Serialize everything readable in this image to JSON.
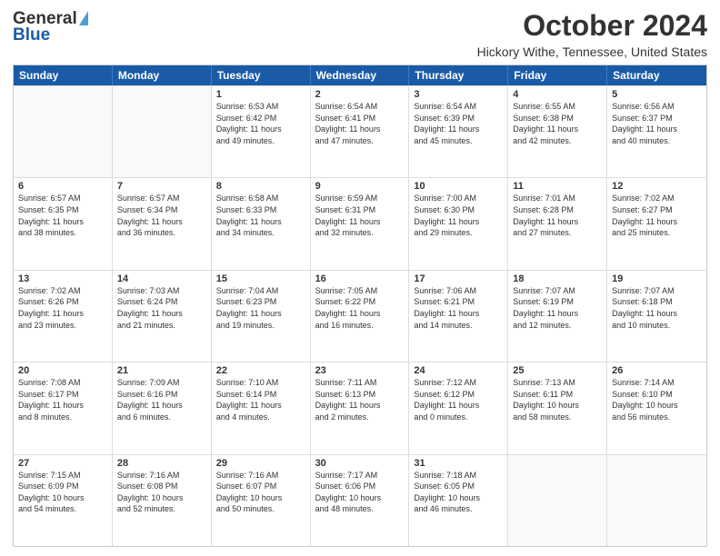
{
  "header": {
    "logo_general": "General",
    "logo_blue": "Blue",
    "month_title": "October 2024",
    "location": "Hickory Withe, Tennessee, United States"
  },
  "days_of_week": [
    "Sunday",
    "Monday",
    "Tuesday",
    "Wednesday",
    "Thursday",
    "Friday",
    "Saturday"
  ],
  "weeks": [
    [
      {
        "num": "",
        "info": ""
      },
      {
        "num": "",
        "info": ""
      },
      {
        "num": "1",
        "info": "Sunrise: 6:53 AM\nSunset: 6:42 PM\nDaylight: 11 hours\nand 49 minutes."
      },
      {
        "num": "2",
        "info": "Sunrise: 6:54 AM\nSunset: 6:41 PM\nDaylight: 11 hours\nand 47 minutes."
      },
      {
        "num": "3",
        "info": "Sunrise: 6:54 AM\nSunset: 6:39 PM\nDaylight: 11 hours\nand 45 minutes."
      },
      {
        "num": "4",
        "info": "Sunrise: 6:55 AM\nSunset: 6:38 PM\nDaylight: 11 hours\nand 42 minutes."
      },
      {
        "num": "5",
        "info": "Sunrise: 6:56 AM\nSunset: 6:37 PM\nDaylight: 11 hours\nand 40 minutes."
      }
    ],
    [
      {
        "num": "6",
        "info": "Sunrise: 6:57 AM\nSunset: 6:35 PM\nDaylight: 11 hours\nand 38 minutes."
      },
      {
        "num": "7",
        "info": "Sunrise: 6:57 AM\nSunset: 6:34 PM\nDaylight: 11 hours\nand 36 minutes."
      },
      {
        "num": "8",
        "info": "Sunrise: 6:58 AM\nSunset: 6:33 PM\nDaylight: 11 hours\nand 34 minutes."
      },
      {
        "num": "9",
        "info": "Sunrise: 6:59 AM\nSunset: 6:31 PM\nDaylight: 11 hours\nand 32 minutes."
      },
      {
        "num": "10",
        "info": "Sunrise: 7:00 AM\nSunset: 6:30 PM\nDaylight: 11 hours\nand 29 minutes."
      },
      {
        "num": "11",
        "info": "Sunrise: 7:01 AM\nSunset: 6:28 PM\nDaylight: 11 hours\nand 27 minutes."
      },
      {
        "num": "12",
        "info": "Sunrise: 7:02 AM\nSunset: 6:27 PM\nDaylight: 11 hours\nand 25 minutes."
      }
    ],
    [
      {
        "num": "13",
        "info": "Sunrise: 7:02 AM\nSunset: 6:26 PM\nDaylight: 11 hours\nand 23 minutes."
      },
      {
        "num": "14",
        "info": "Sunrise: 7:03 AM\nSunset: 6:24 PM\nDaylight: 11 hours\nand 21 minutes."
      },
      {
        "num": "15",
        "info": "Sunrise: 7:04 AM\nSunset: 6:23 PM\nDaylight: 11 hours\nand 19 minutes."
      },
      {
        "num": "16",
        "info": "Sunrise: 7:05 AM\nSunset: 6:22 PM\nDaylight: 11 hours\nand 16 minutes."
      },
      {
        "num": "17",
        "info": "Sunrise: 7:06 AM\nSunset: 6:21 PM\nDaylight: 11 hours\nand 14 minutes."
      },
      {
        "num": "18",
        "info": "Sunrise: 7:07 AM\nSunset: 6:19 PM\nDaylight: 11 hours\nand 12 minutes."
      },
      {
        "num": "19",
        "info": "Sunrise: 7:07 AM\nSunset: 6:18 PM\nDaylight: 11 hours\nand 10 minutes."
      }
    ],
    [
      {
        "num": "20",
        "info": "Sunrise: 7:08 AM\nSunset: 6:17 PM\nDaylight: 11 hours\nand 8 minutes."
      },
      {
        "num": "21",
        "info": "Sunrise: 7:09 AM\nSunset: 6:16 PM\nDaylight: 11 hours\nand 6 minutes."
      },
      {
        "num": "22",
        "info": "Sunrise: 7:10 AM\nSunset: 6:14 PM\nDaylight: 11 hours\nand 4 minutes."
      },
      {
        "num": "23",
        "info": "Sunrise: 7:11 AM\nSunset: 6:13 PM\nDaylight: 11 hours\nand 2 minutes."
      },
      {
        "num": "24",
        "info": "Sunrise: 7:12 AM\nSunset: 6:12 PM\nDaylight: 11 hours\nand 0 minutes."
      },
      {
        "num": "25",
        "info": "Sunrise: 7:13 AM\nSunset: 6:11 PM\nDaylight: 10 hours\nand 58 minutes."
      },
      {
        "num": "26",
        "info": "Sunrise: 7:14 AM\nSunset: 6:10 PM\nDaylight: 10 hours\nand 56 minutes."
      }
    ],
    [
      {
        "num": "27",
        "info": "Sunrise: 7:15 AM\nSunset: 6:09 PM\nDaylight: 10 hours\nand 54 minutes."
      },
      {
        "num": "28",
        "info": "Sunrise: 7:16 AM\nSunset: 6:08 PM\nDaylight: 10 hours\nand 52 minutes."
      },
      {
        "num": "29",
        "info": "Sunrise: 7:16 AM\nSunset: 6:07 PM\nDaylight: 10 hours\nand 50 minutes."
      },
      {
        "num": "30",
        "info": "Sunrise: 7:17 AM\nSunset: 6:06 PM\nDaylight: 10 hours\nand 48 minutes."
      },
      {
        "num": "31",
        "info": "Sunrise: 7:18 AM\nSunset: 6:05 PM\nDaylight: 10 hours\nand 46 minutes."
      },
      {
        "num": "",
        "info": ""
      },
      {
        "num": "",
        "info": ""
      }
    ]
  ]
}
